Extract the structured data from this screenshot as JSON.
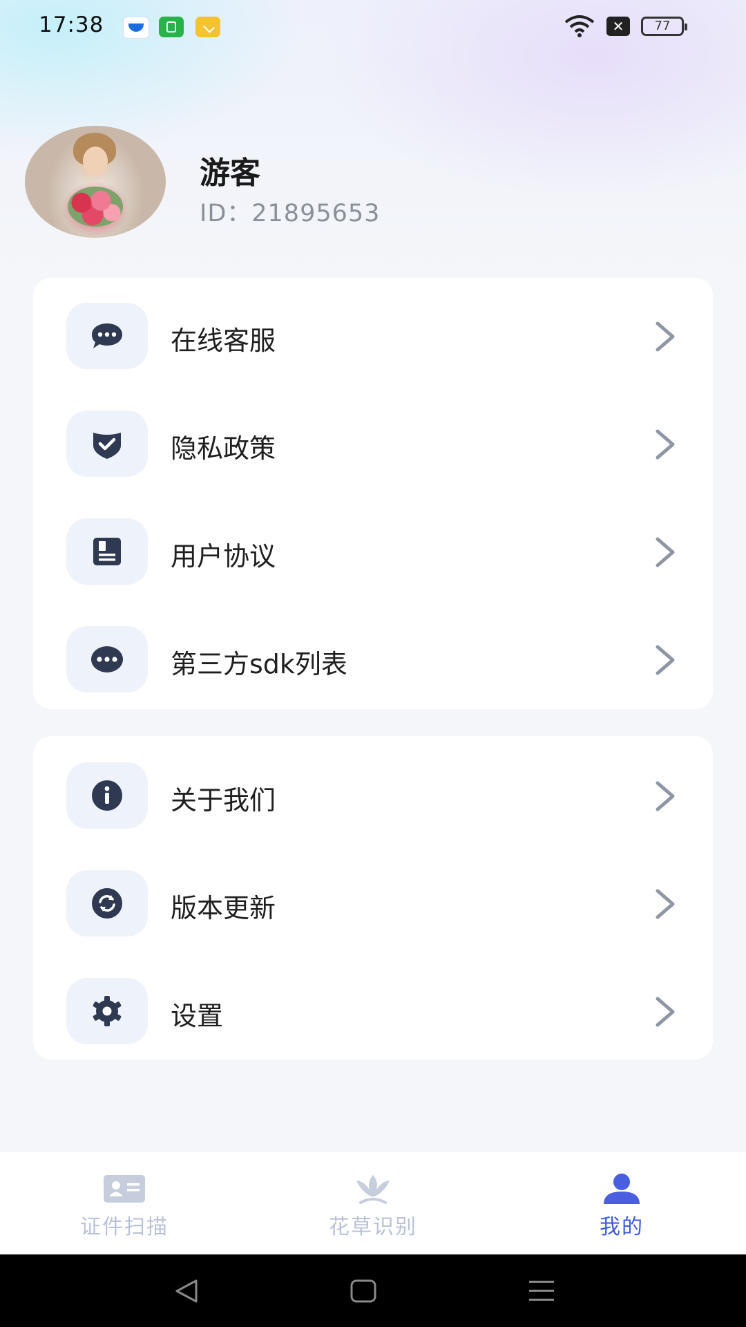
{
  "status_bar": {
    "time": "17:38",
    "battery": "77",
    "icons": [
      "app-notification-icon",
      "app-notification-icon",
      "app-notification-icon",
      "wifi-icon",
      "sim-off-icon",
      "battery-icon"
    ]
  },
  "profile": {
    "name": "游客",
    "id_text": "ID：21895653"
  },
  "menu_group_1": [
    {
      "label": "在线客服",
      "icon": "chat-bubble-icon"
    },
    {
      "label": "隐私政策",
      "icon": "shield-check-icon"
    },
    {
      "label": "用户协议",
      "icon": "document-icon"
    },
    {
      "label": "第三方sdk列表",
      "icon": "more-dots-icon"
    }
  ],
  "menu_group_2": [
    {
      "label": "关于我们",
      "icon": "info-icon"
    },
    {
      "label": "版本更新",
      "icon": "refresh-icon"
    },
    {
      "label": "设置",
      "icon": "gear-icon"
    }
  ],
  "bottom_nav": {
    "tabs": [
      {
        "label": "证件扫描",
        "icon": "id-card-icon",
        "active": false
      },
      {
        "label": "花草识别",
        "icon": "lotus-icon",
        "active": false
      },
      {
        "label": "我的",
        "icon": "person-icon",
        "active": true
      }
    ],
    "active_color": "#3f5bd8",
    "inactive_color": "#b9c2d6"
  }
}
